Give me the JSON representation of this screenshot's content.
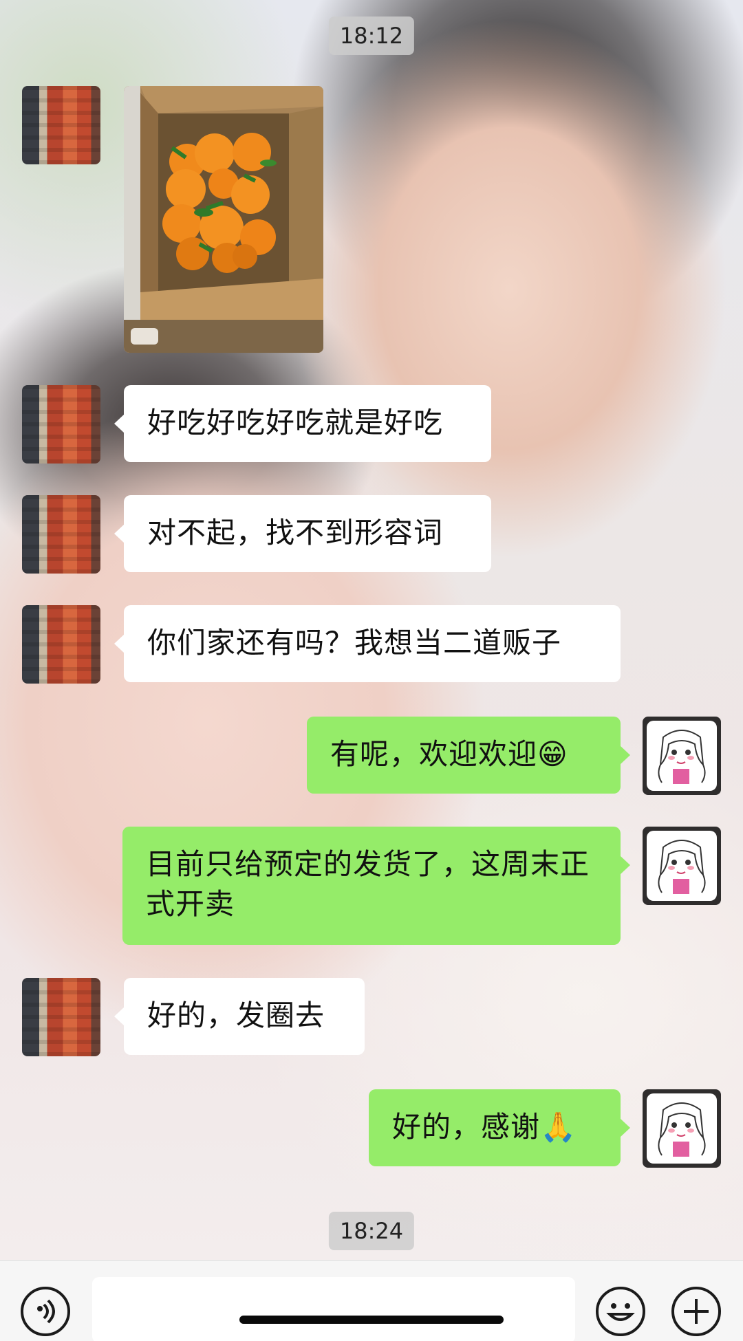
{
  "timestamps": {
    "first": "18:12",
    "last": "18:24"
  },
  "messages": [
    {
      "side": "left",
      "type": "image",
      "alt": "box of oranges photo"
    },
    {
      "side": "left",
      "type": "text",
      "text": "好吃好吃好吃就是好吃"
    },
    {
      "side": "left",
      "type": "text",
      "text": "对不起，找不到形容词"
    },
    {
      "side": "left",
      "type": "text",
      "text": "你们家还有吗？我想当二道贩子"
    },
    {
      "side": "right",
      "type": "text",
      "text": "有呢，欢迎欢迎😁"
    },
    {
      "side": "right",
      "type": "text",
      "text": "目前只给预定的发货了，这周末正式开卖"
    },
    {
      "side": "left",
      "type": "text",
      "text": "好的，发圈去"
    },
    {
      "side": "right",
      "type": "text",
      "text": "好的，感谢🙏"
    }
  ],
  "input_bar": {
    "voice_icon": "voice-icon",
    "emoji_icon": "smile-icon",
    "plus_icon": "plus-icon",
    "value": "",
    "placeholder": ""
  },
  "colors": {
    "bubble_left": "#ffffff",
    "bubble_right": "#95ec69",
    "timestamp_bg": "#cdcdcd"
  }
}
